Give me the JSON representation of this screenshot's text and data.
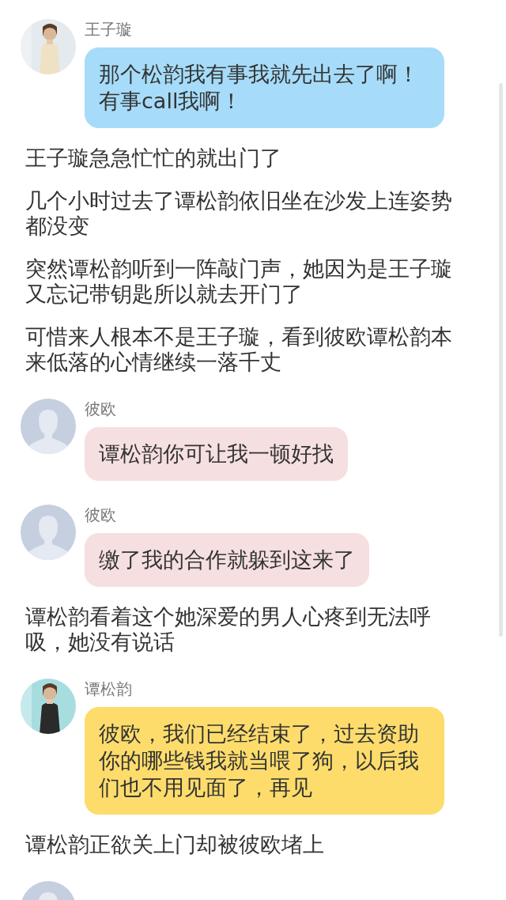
{
  "items": [
    {
      "kind": "message",
      "name": "王子璇",
      "text": "那个松韵我有事我就先出去了啊！有事call我啊！",
      "color": "#a6dcf9"
    },
    {
      "kind": "narration",
      "text": "王子璇急急忙忙的就出门了"
    },
    {
      "kind": "narration",
      "text": "几个小时过去了谭松韵依旧坐在沙发上连姿势都没变"
    },
    {
      "kind": "narration",
      "text": "突然谭松韵听到一阵敲门声，她因为是王子璇又忘记带钥匙所以就去开门了"
    },
    {
      "kind": "narration",
      "text": "可惜来人根本不是王子璇，看到彼欧谭松韵本来低落的心情继续一落千丈"
    },
    {
      "kind": "message",
      "avatar": {
        "kind": "placeholder"
      },
      "name": "彼欧",
      "text": "谭松韵你可让我一顿好找",
      "color": "#f6dfe0"
    },
    {
      "kind": "message",
      "avatar": {
        "kind": "placeholder"
      },
      "name": "彼欧",
      "text": "缴了我的合作就躲到这来了",
      "color": "#f6dfe0"
    },
    {
      "kind": "narration",
      "text": "谭松韵看着这个她深爱的男人心疼到无法呼吸，她没有说话"
    },
    {
      "kind": "message",
      "name": "谭松韵",
      "text": "彼欧，我们已经结束了，过去资助你的哪些钱我就当喂了狗，以后我们也不用见面了，再见",
      "color": "#fddc6c"
    },
    {
      "kind": "narration",
      "text": "谭松韵正欲关上门却被彼欧堵上"
    },
    {
      "kind": "avatar_only",
      "avatar": {
        "kind": "placeholder"
      }
    }
  ]
}
